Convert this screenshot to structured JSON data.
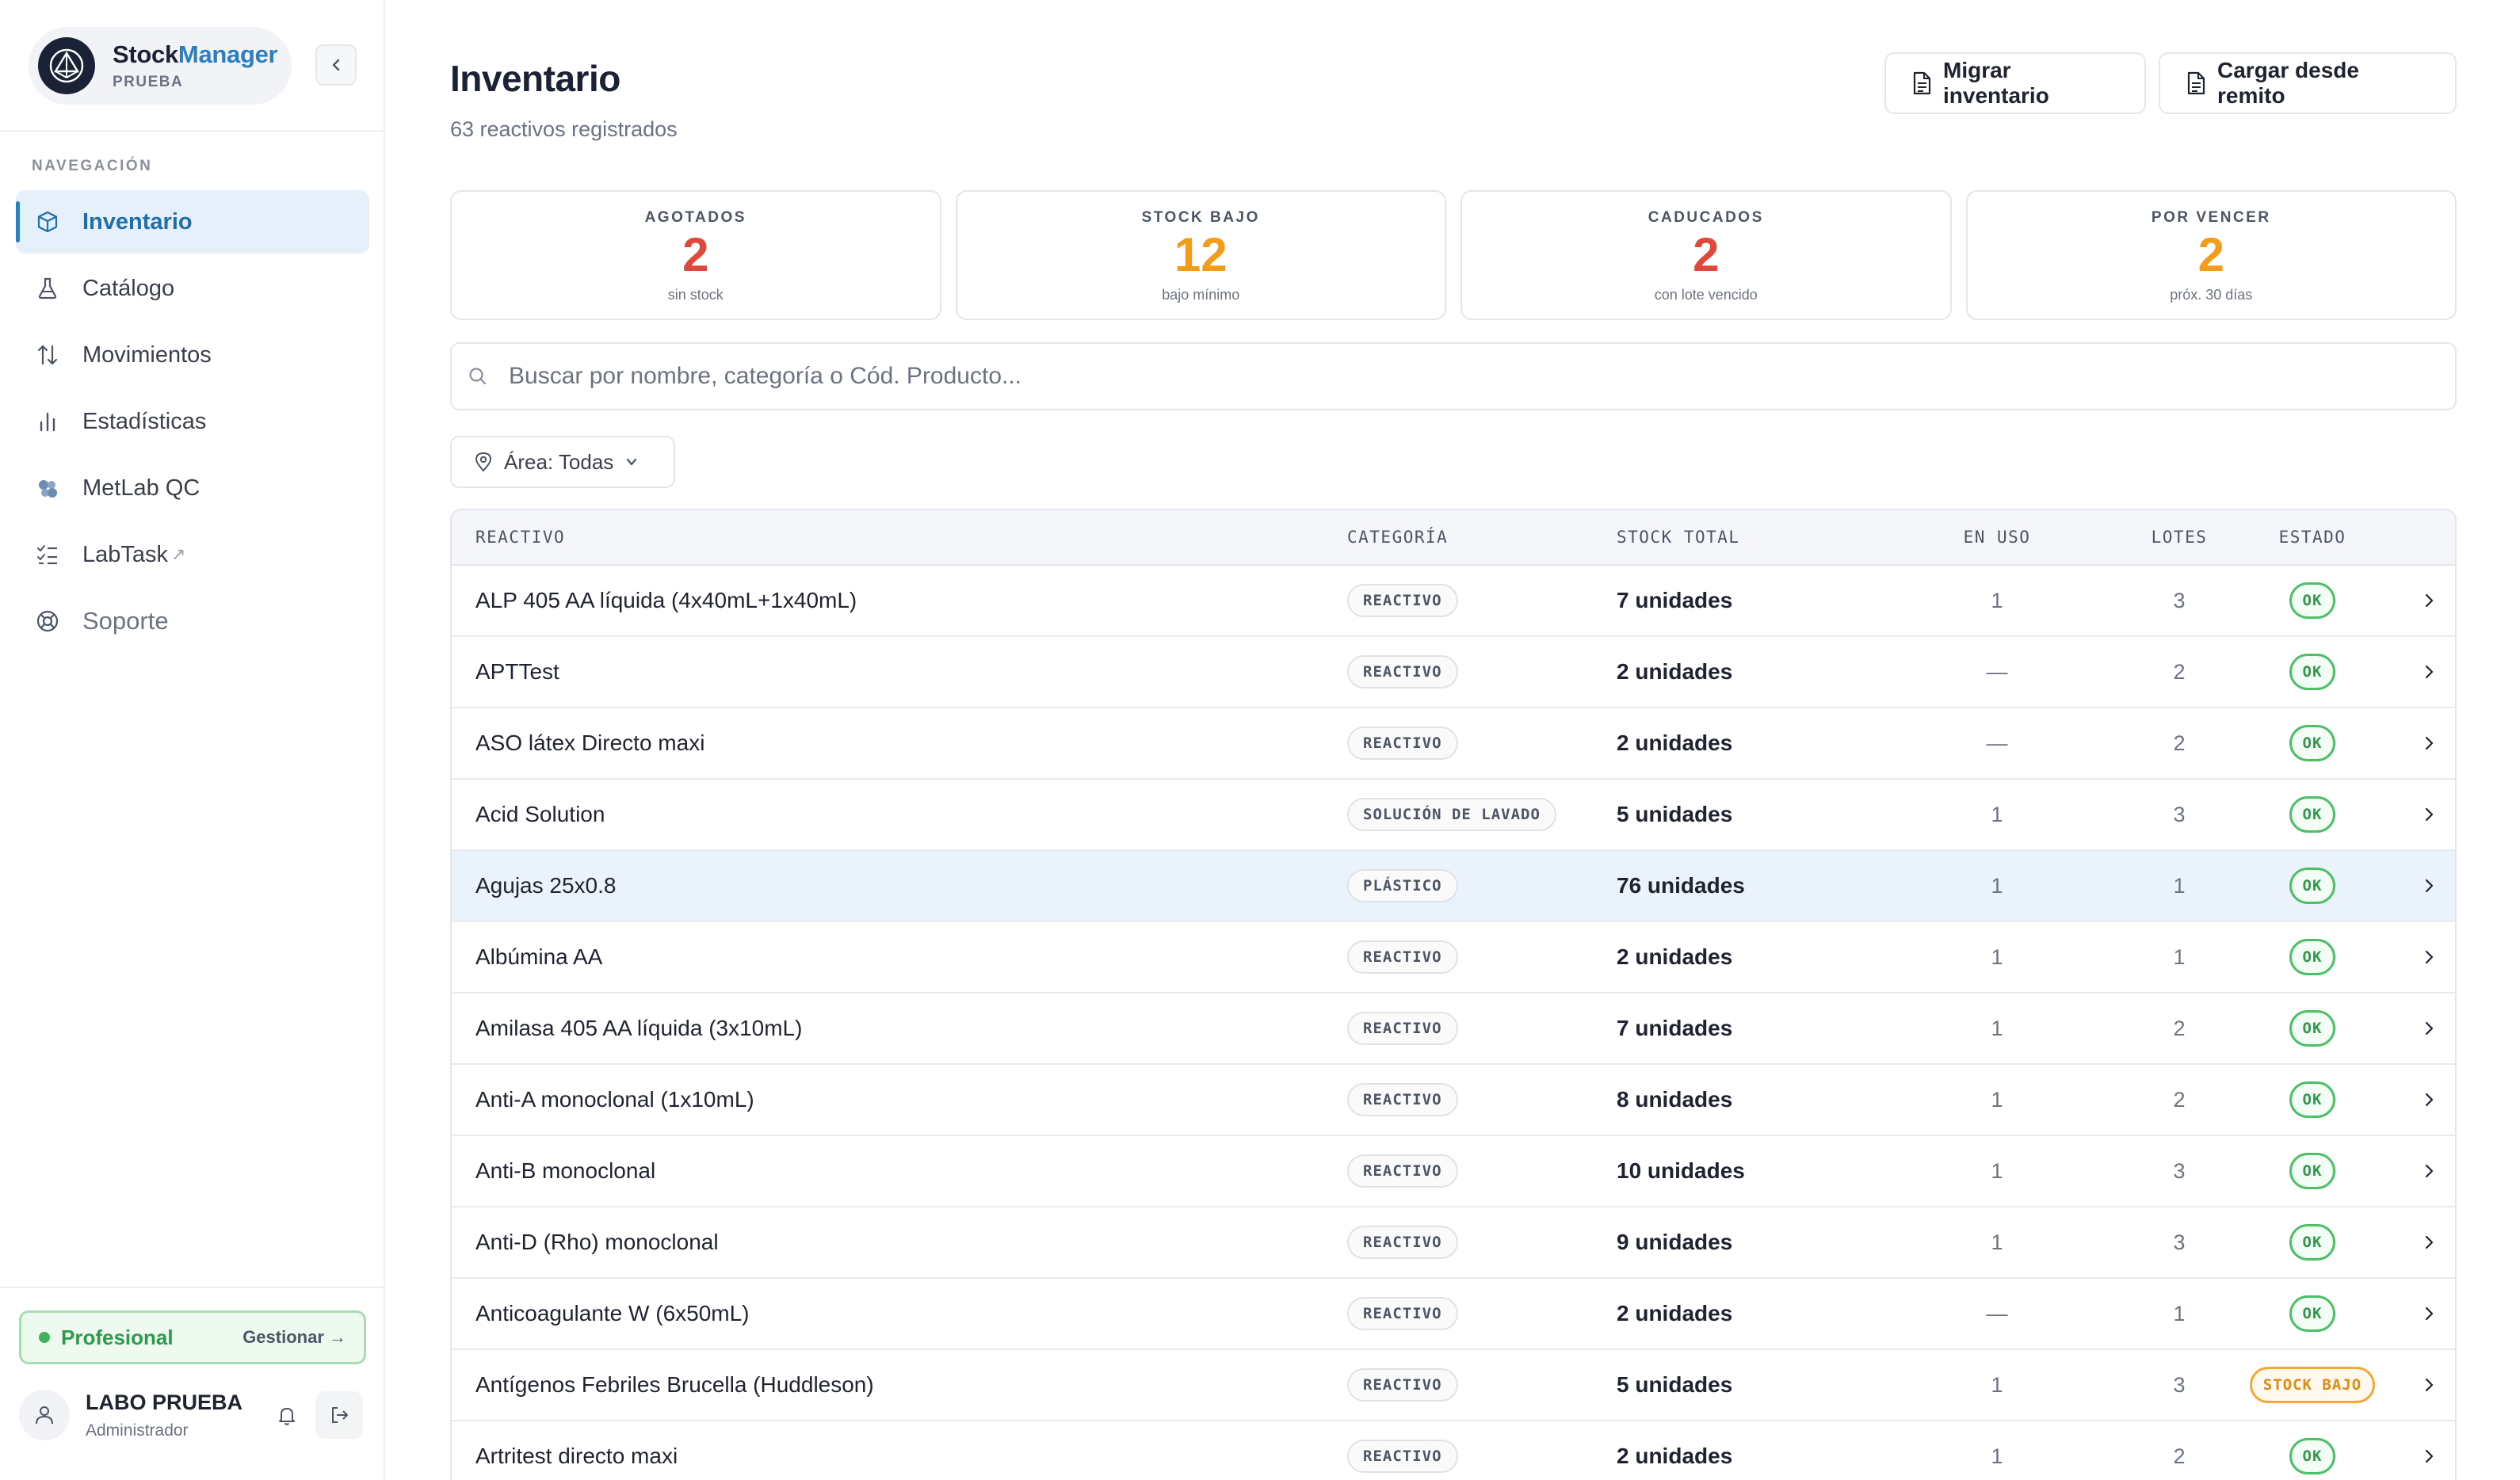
{
  "brand": {
    "name_part1": "Stock",
    "name_part2": "Manager",
    "subtitle": "PRUEBA"
  },
  "nav": {
    "heading": "NAVEGACIÓN",
    "items": [
      {
        "label": "Inventario",
        "icon": "box-icon"
      },
      {
        "label": "Catálogo",
        "icon": "flask-icon"
      },
      {
        "label": "Movimientos",
        "icon": "arrows-updown-icon"
      },
      {
        "label": "Estadísticas",
        "icon": "bar-chart-icon"
      },
      {
        "label": "MetLab QC",
        "icon": "puzzle-icon"
      },
      {
        "label": "LabTask",
        "icon": "checklist-icon"
      },
      {
        "label": "Soporte",
        "icon": "lifebuoy-icon"
      }
    ]
  },
  "plan": {
    "label": "Profesional",
    "manage": "Gestionar →"
  },
  "user": {
    "name": "LABO PRUEBA",
    "role": "Administrador"
  },
  "header": {
    "title": "Inventario",
    "subtitle": "63 reactivos registrados",
    "btn_migrate": "Migrar inventario",
    "btn_remito": "Cargar desde remito"
  },
  "stats": [
    {
      "label": "AGOTADOS",
      "value": "2",
      "note": "sin stock",
      "color": "#e0483b"
    },
    {
      "label": "STOCK BAJO",
      "value": "12",
      "note": "bajo mínimo",
      "color": "#f39c1a"
    },
    {
      "label": "CADUCADOS",
      "value": "2",
      "note": "con lote vencido",
      "color": "#e0483b"
    },
    {
      "label": "POR VENCER",
      "value": "2",
      "note": "próx. 30 días",
      "color": "#f39c1a"
    }
  ],
  "search": {
    "placeholder": "Buscar por nombre, categoría o Cód. Producto..."
  },
  "filter": {
    "area_label": "Área: Todas"
  },
  "table": {
    "headers": {
      "name": "REACTIVO",
      "category": "CATEGORÍA",
      "stock": "STOCK TOTAL",
      "in_use": "EN USO",
      "lots": "LOTES",
      "status": "ESTADO"
    },
    "rows": [
      {
        "name": "ALP 405 AA líquida (4x40mL+1x40mL)",
        "category": "REACTIVO",
        "stock": "7 unidades",
        "in_use": "1",
        "lots": "3",
        "status": "OK"
      },
      {
        "name": "APTTest",
        "category": "REACTIVO",
        "stock": "2 unidades",
        "in_use": "—",
        "lots": "2",
        "status": "OK"
      },
      {
        "name": "ASO látex Directo maxi",
        "category": "REACTIVO",
        "stock": "2 unidades",
        "in_use": "—",
        "lots": "2",
        "status": "OK"
      },
      {
        "name": "Acid Solution",
        "category": "SOLUCIÓN DE LAVADO",
        "stock": "5 unidades",
        "in_use": "1",
        "lots": "3",
        "status": "OK"
      },
      {
        "name": "Agujas 25x0.8",
        "category": "PLÁSTICO",
        "stock": "76 unidades",
        "in_use": "1",
        "lots": "1",
        "status": "OK"
      },
      {
        "name": "Albúmina AA",
        "category": "REACTIVO",
        "stock": "2 unidades",
        "in_use": "1",
        "lots": "1",
        "status": "OK"
      },
      {
        "name": "Amilasa 405 AA líquida (3x10mL)",
        "category": "REACTIVO",
        "stock": "7 unidades",
        "in_use": "1",
        "lots": "2",
        "status": "OK"
      },
      {
        "name": "Anti-A monoclonal (1x10mL)",
        "category": "REACTIVO",
        "stock": "8 unidades",
        "in_use": "1",
        "lots": "2",
        "status": "OK"
      },
      {
        "name": "Anti-B monoclonal",
        "category": "REACTIVO",
        "stock": "10 unidades",
        "in_use": "1",
        "lots": "3",
        "status": "OK"
      },
      {
        "name": "Anti-D (Rho) monoclonal",
        "category": "REACTIVO",
        "stock": "9 unidades",
        "in_use": "1",
        "lots": "3",
        "status": "OK"
      },
      {
        "name": "Anticoagulante W (6x50mL)",
        "category": "REACTIVO",
        "stock": "2 unidades",
        "in_use": "—",
        "lots": "1",
        "status": "OK"
      },
      {
        "name": "Antígenos Febriles Brucella (Huddleson)",
        "category": "REACTIVO",
        "stock": "5 unidades",
        "in_use": "1",
        "lots": "3",
        "status": "STOCK BAJO"
      },
      {
        "name": "Artritest directo maxi",
        "category": "REACTIVO",
        "stock": "2 unidades",
        "in_use": "1",
        "lots": "2",
        "status": "OK"
      }
    ]
  },
  "colors": {
    "accent": "#2b7fc0",
    "ok": "#2e9a4b",
    "low": "#e08a0f",
    "danger": "#e0483b",
    "warning": "#f39c1a"
  }
}
